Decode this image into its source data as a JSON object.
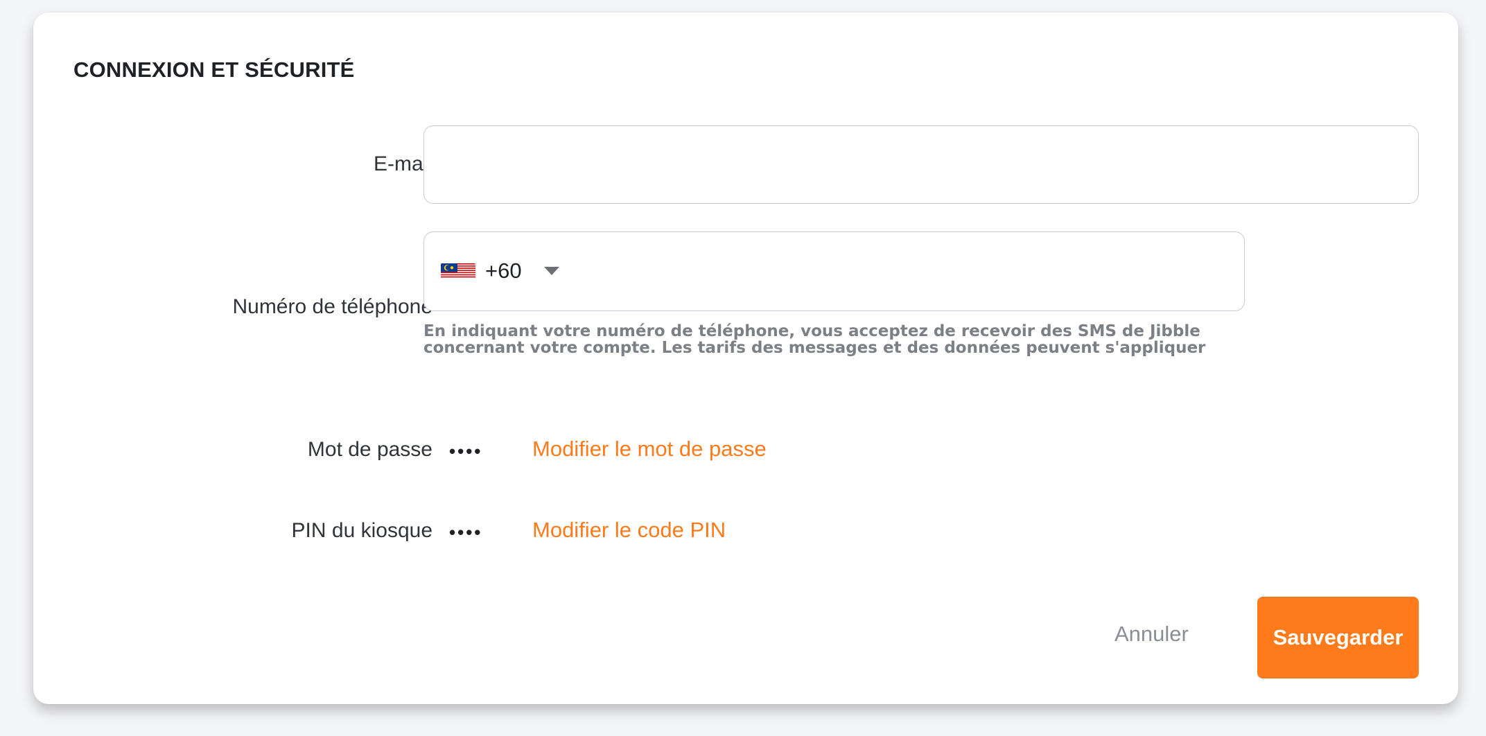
{
  "section": {
    "title": "CONNEXION ET SÉCURITÉ"
  },
  "email": {
    "label": "E-mail",
    "value": "",
    "placeholder": ""
  },
  "phone": {
    "label": "Numéro de téléphone",
    "country_flag": "malaysia-flag-icon",
    "dial_code": "+60",
    "value": "",
    "hint": "En indiquant votre numéro de téléphone, vous acceptez de recevoir des SMS de Jibble concernant votre compte. Les tarifs des messages et des données peuvent s'appliquer"
  },
  "password": {
    "label": "Mot de passe",
    "masked": "••••",
    "change_link": "Modifier le mot de passe"
  },
  "pin": {
    "label": "PIN du kiosque",
    "masked": "••••",
    "change_link": "Modifier le code PIN"
  },
  "actions": {
    "cancel_label": "Annuler",
    "save_label": "Sauvegarder"
  },
  "colors": {
    "accent": "#ff7a1a",
    "muted_text": "#7b7f86",
    "border": "#c7cbd1",
    "background": "#f4f5f8"
  }
}
